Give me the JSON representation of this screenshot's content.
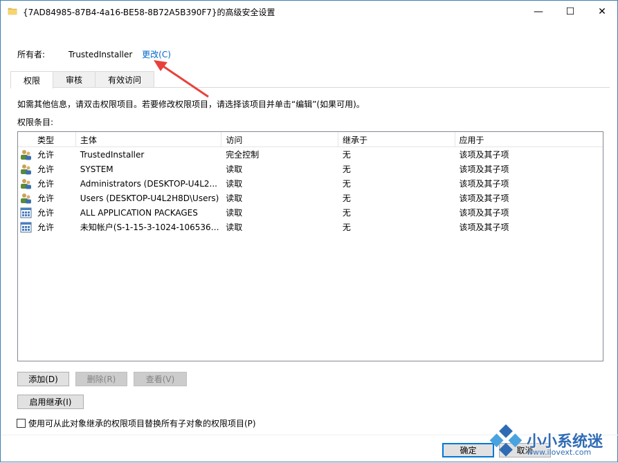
{
  "window": {
    "title": "{7AD84985-87B4-4a16-BE58-8B72A5B390F7}的高级安全设置",
    "icon": "folder-icon",
    "controls": {
      "minimize": "—",
      "maximize": "☐",
      "close": "✕"
    }
  },
  "owner": {
    "label": "所有者:",
    "value": "TrustedInstaller",
    "change_link": "更改(C)"
  },
  "tabs": [
    {
      "label": "权限",
      "active": true
    },
    {
      "label": "审核",
      "active": false
    },
    {
      "label": "有效访问",
      "active": false
    }
  ],
  "info_text": "如需其他信息，请双击权限项目。若要修改权限项目，请选择该项目并单击“编辑”(如果可用)。",
  "entries_label": "权限条目:",
  "table": {
    "headers": [
      "类型",
      "主体",
      "访问",
      "继承于",
      "应用于"
    ],
    "rows": [
      {
        "icon": "user-group-icon",
        "type": "允许",
        "principal": "TrustedInstaller",
        "access": "完全控制",
        "inherited": "无",
        "applies": "该项及其子项"
      },
      {
        "icon": "user-group-icon",
        "type": "允许",
        "principal": "SYSTEM",
        "access": "读取",
        "inherited": "无",
        "applies": "该项及其子项"
      },
      {
        "icon": "user-group-icon",
        "type": "允许",
        "principal": "Administrators (DESKTOP-U4L2...",
        "access": "读取",
        "inherited": "无",
        "applies": "该项及其子项"
      },
      {
        "icon": "user-group-icon",
        "type": "允许",
        "principal": "Users (DESKTOP-U4L2H8D\\Users)",
        "access": "读取",
        "inherited": "无",
        "applies": "该项及其子项"
      },
      {
        "icon": "app-package-icon",
        "type": "允许",
        "principal": "ALL APPLICATION PACKAGES",
        "access": "读取",
        "inherited": "无",
        "applies": "该项及其子项"
      },
      {
        "icon": "app-package-icon",
        "type": "允许",
        "principal": "未知帐户(S-1-15-3-1024-1065365...",
        "access": "读取",
        "inherited": "无",
        "applies": "该项及其子项"
      }
    ]
  },
  "buttons": {
    "add": "添加(D)",
    "remove": "删除(R)",
    "view": "查看(V)",
    "enable_inheritance": "启用继承(I)",
    "ok": "确定",
    "cancel": "取消"
  },
  "checkbox": {
    "label": "使用可从此对象继承的权限项目替换所有子对象的权限项目(P)",
    "checked": false
  },
  "watermark": {
    "name": "小小系统迷",
    "url": "www.ilovext.com"
  },
  "colors": {
    "link": "#0066cc",
    "accent": "#0078d7",
    "annotation_arrow": "#e8413c"
  }
}
